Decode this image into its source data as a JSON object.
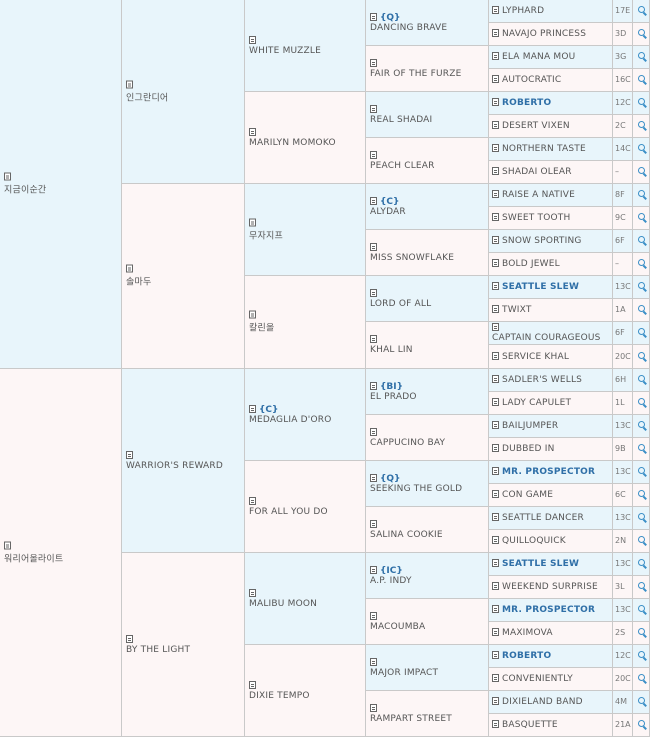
{
  "gen1": [
    {
      "name": "지금이순간"
    },
    {
      "name": "워리어올라이트"
    }
  ],
  "gen2": [
    {
      "name": "인그란디어"
    },
    {
      "name": "솔마두"
    },
    {
      "name": "WARRIOR'S REWARD"
    },
    {
      "name": "BY THE LIGHT"
    }
  ],
  "gen3": [
    {
      "name": "WHITE MUZZLE",
      "tag": ""
    },
    {
      "name": "MARILYN MOMOKO",
      "tag": ""
    },
    {
      "name": "무자지프",
      "tag": ""
    },
    {
      "name": "칼린올",
      "tag": ""
    },
    {
      "name": "MEDAGLIA D'ORO",
      "tag": "{C}"
    },
    {
      "name": "FOR ALL YOU DO",
      "tag": ""
    },
    {
      "name": "MALIBU MOON",
      "tag": ""
    },
    {
      "name": "DIXIE TEMPO",
      "tag": ""
    }
  ],
  "gen4": [
    {
      "name": "DANCING BRAVE",
      "tag": "{Q}"
    },
    {
      "name": "FAIR OF THE FURZE",
      "tag": ""
    },
    {
      "name": "REAL SHADAI",
      "tag": ""
    },
    {
      "name": "PEACH CLEAR",
      "tag": ""
    },
    {
      "name": "ALYDAR",
      "tag": "{C}"
    },
    {
      "name": "MISS SNOWFLAKE",
      "tag": ""
    },
    {
      "name": "LORD OF ALL",
      "tag": ""
    },
    {
      "name": "KHAL LIN",
      "tag": ""
    },
    {
      "name": "EL PRADO",
      "tag": "{BI}"
    },
    {
      "name": "CAPPUCINO BAY",
      "tag": ""
    },
    {
      "name": "SEEKING THE GOLD",
      "tag": "{Q}"
    },
    {
      "name": "SALINA COOKIE",
      "tag": ""
    },
    {
      "name": "A.P. INDY",
      "tag": "{IC}"
    },
    {
      "name": "MACOUMBA",
      "tag": ""
    },
    {
      "name": "MAJOR IMPACT",
      "tag": ""
    },
    {
      "name": "RAMPART STREET",
      "tag": ""
    }
  ],
  "gen5": [
    {
      "name": "LYPHARD",
      "code": "17E",
      "bold": false
    },
    {
      "name": "NAVAJO PRINCESS",
      "code": "3D",
      "bold": false
    },
    {
      "name": "ELA MANA MOU",
      "code": "3G",
      "bold": false
    },
    {
      "name": "AUTOCRATIC",
      "code": "16C",
      "bold": false
    },
    {
      "name": "ROBERTO",
      "code": "12C",
      "bold": true
    },
    {
      "name": "DESERT VIXEN",
      "code": "2C",
      "bold": false
    },
    {
      "name": "NORTHERN TASTE",
      "code": "14C",
      "bold": false
    },
    {
      "name": "SHADAI OLEAR",
      "code": "–",
      "bold": false
    },
    {
      "name": "RAISE A NATIVE",
      "code": "8F",
      "bold": false
    },
    {
      "name": "SWEET TOOTH",
      "code": "9C",
      "bold": false
    },
    {
      "name": "SNOW SPORTING",
      "code": "6F",
      "bold": false
    },
    {
      "name": "BOLD JEWEL",
      "code": "–",
      "bold": false
    },
    {
      "name": "SEATTLE SLEW",
      "code": "13C",
      "bold": true
    },
    {
      "name": "TWIXT",
      "code": "1A",
      "bold": false
    },
    {
      "name": "CAPTAIN COURAGEOUS",
      "code": "6F",
      "bold": false
    },
    {
      "name": "SERVICE KHAL",
      "code": "20C",
      "bold": false
    },
    {
      "name": "SADLER'S WELLS",
      "code": "6H",
      "bold": false
    },
    {
      "name": "LADY CAPULET",
      "code": "1L",
      "bold": false
    },
    {
      "name": "BAILJUMPER",
      "code": "13C",
      "bold": false
    },
    {
      "name": "DUBBED IN",
      "code": "9B",
      "bold": false
    },
    {
      "name": "MR. PROSPECTOR",
      "code": "13C",
      "bold": true
    },
    {
      "name": "CON GAME",
      "code": "6C",
      "bold": false
    },
    {
      "name": "SEATTLE DANCER",
      "code": "13C",
      "bold": false
    },
    {
      "name": "QUILLOQUICK",
      "code": "2N",
      "bold": false
    },
    {
      "name": "SEATTLE SLEW",
      "code": "13C",
      "bold": true
    },
    {
      "name": "WEEKEND SURPRISE",
      "code": "3L",
      "bold": false
    },
    {
      "name": "MR. PROSPECTOR",
      "code": "13C",
      "bold": true
    },
    {
      "name": "MAXIMOVA",
      "code": "2S",
      "bold": false
    },
    {
      "name": "ROBERTO",
      "code": "12C",
      "bold": true
    },
    {
      "name": "CONVENIENTLY",
      "code": "20C",
      "bold": false
    },
    {
      "name": "DIXIELAND BAND",
      "code": "4M",
      "bold": false
    },
    {
      "name": "BASQUETTE",
      "code": "21A",
      "bold": false
    }
  ],
  "colors": {
    "sire_bg": "#e8f5fb",
    "dam_bg": "#fdf6f6",
    "link_blue": "#2f6fa7",
    "border": "#c9c9c9"
  },
  "icons": {
    "document": "document-icon",
    "search": "search-icon"
  }
}
